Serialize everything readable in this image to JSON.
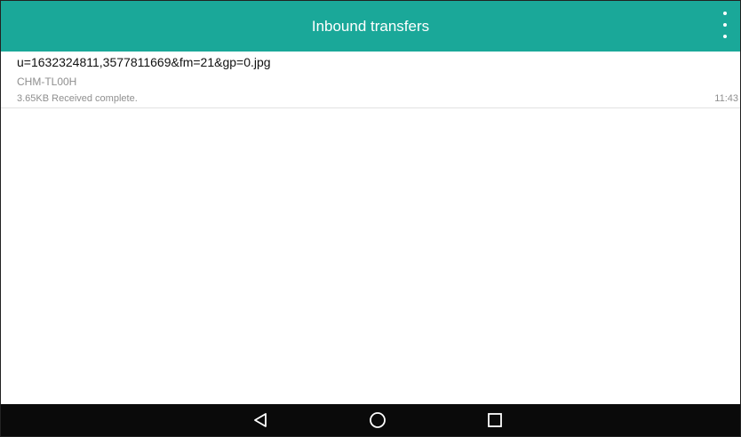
{
  "header": {
    "title": "Inbound transfers",
    "menu_icon": "overflow-menu-icon",
    "color": "#1aa899"
  },
  "transfers": [
    {
      "file_name": "u=1632324811,3577811669&fm=21&gp=0.jpg",
      "device": "CHM-TL00H",
      "status": "3.65KB Received complete.",
      "time": "11:43"
    }
  ],
  "navbar": {
    "back_icon": "back-triangle-icon",
    "home_icon": "home-circle-icon",
    "recents_icon": "recents-square-icon",
    "color": "#0a0a0a"
  }
}
